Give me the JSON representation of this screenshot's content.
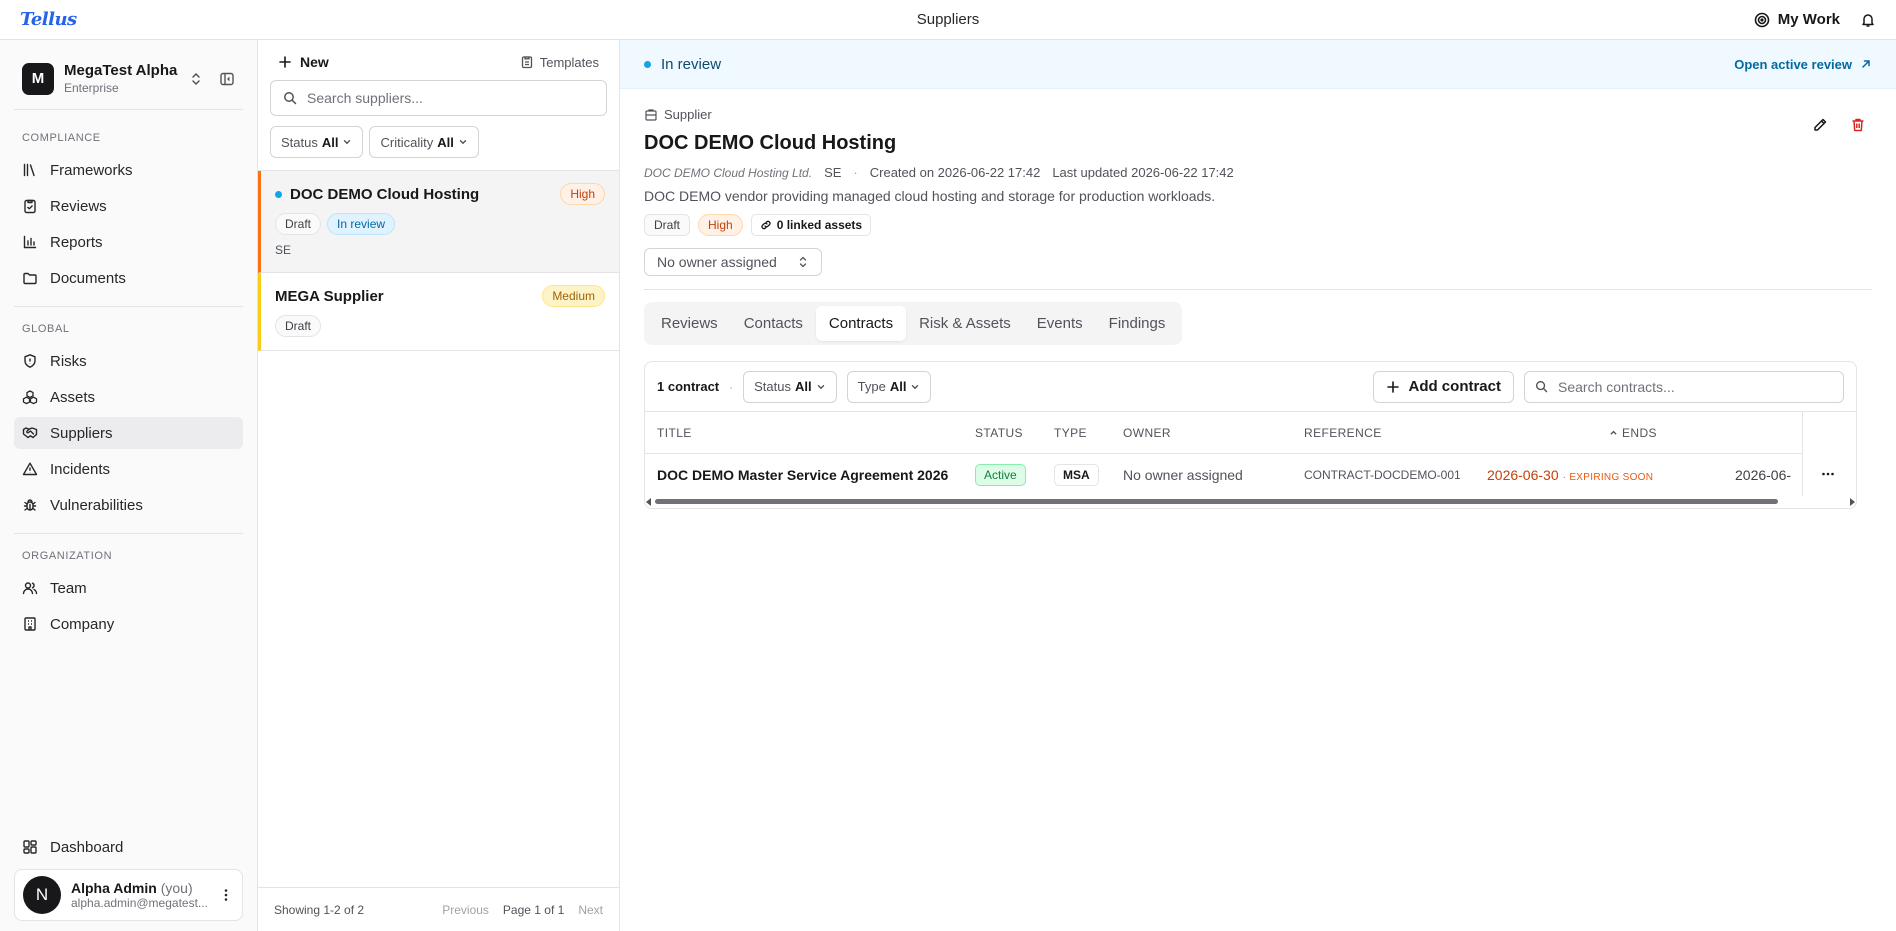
{
  "topbar": {
    "logo": "Tellus",
    "page_title": "Suppliers",
    "my_work": "My Work"
  },
  "sidebar": {
    "org_initial": "M",
    "org_name": "MegaTest Alpha",
    "org_plan": "Enterprise",
    "sections": {
      "compliance": "COMPLIANCE",
      "global": "GLOBAL",
      "organization": "ORGANIZATION"
    },
    "compliance_items": [
      "Frameworks",
      "Reviews",
      "Reports",
      "Documents"
    ],
    "global_items": [
      "Risks",
      "Assets",
      "Suppliers",
      "Incidents",
      "Vulnerabilities"
    ],
    "organization_items": [
      "Team",
      "Company"
    ],
    "dashboard": "Dashboard",
    "user": {
      "initial": "N",
      "name": "Alpha Admin",
      "you": "(you)",
      "email": "alpha.admin@megatest..."
    }
  },
  "list": {
    "new_label": "New",
    "templates_label": "Templates",
    "search_placeholder": "Search suppliers...",
    "filters": {
      "status_label": "Status",
      "status_value": "All",
      "criticality_label": "Criticality",
      "criticality_value": "All"
    },
    "suppliers": [
      {
        "name": "DOC DEMO Cloud Hosting",
        "criticality": "High",
        "tags": [
          "Draft",
          "In review"
        ],
        "country": "SE"
      },
      {
        "name": "MEGA Supplier",
        "criticality": "Medium",
        "tags": [
          "Draft"
        ],
        "country": ""
      }
    ],
    "footer": {
      "showing": "Showing 1-2 of 2",
      "previous": "Previous",
      "page": "Page 1 of 1",
      "next": "Next"
    }
  },
  "detail": {
    "banner_status": "In review",
    "banner_link": "Open active review",
    "kicker": "Supplier",
    "title": "DOC DEMO Cloud Hosting",
    "legal_name": "DOC DEMO Cloud Hosting Ltd.",
    "country": "SE",
    "created": "Created on 2026-06-22 17:42",
    "updated": "Last updated 2026-06-22 17:42",
    "description": "DOC DEMO vendor providing managed cloud hosting and storage for production workloads.",
    "tags": {
      "status": "Draft",
      "criticality": "High",
      "linked_assets": "0 linked assets"
    },
    "owner": "No owner assigned",
    "tabs": [
      "Reviews",
      "Contacts",
      "Contracts",
      "Risk & Assets",
      "Events",
      "Findings"
    ],
    "active_tab": "Contracts",
    "contracts": {
      "count": "1 contract",
      "status_label": "Status",
      "status_value": "All",
      "type_label": "Type",
      "type_value": "All",
      "add_label": "Add contract",
      "search_placeholder": "Search contracts...",
      "columns": {
        "title": "TITLE",
        "status": "STATUS",
        "type": "TYPE",
        "owner": "OWNER",
        "reference": "REFERENCE",
        "ends": "ENDS"
      },
      "rows": [
        {
          "title": "DOC DEMO Master Service Agreement 2026",
          "status": "Active",
          "type": "MSA",
          "owner": "No owner assigned",
          "reference": "CONTRACT-DOCDEMO-001",
          "ends": "2026-06-30",
          "ends_note": "· EXPIRING SOON",
          "next_date": "2026-06-"
        }
      ]
    }
  },
  "colors": {
    "brand": "#2563eb",
    "high": "#c2410c",
    "medium": "#a16207",
    "review": "#0369a1",
    "active": "#15803d",
    "delete": "#dc2626"
  }
}
